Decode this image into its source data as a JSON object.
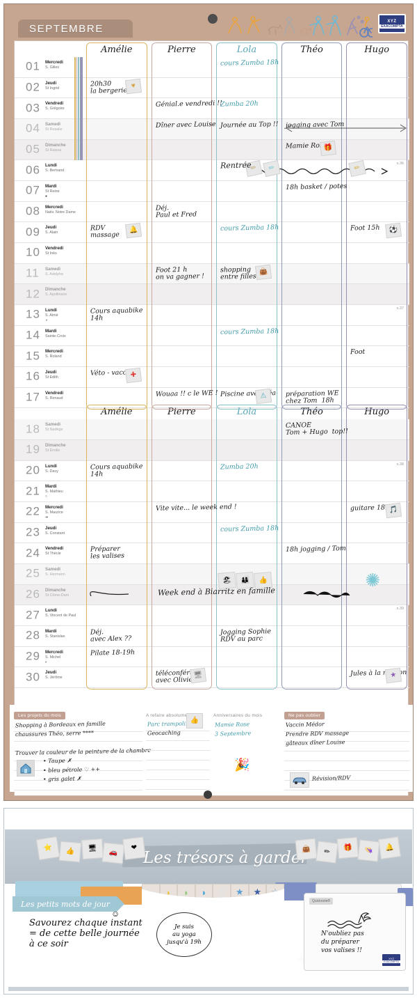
{
  "header": {
    "month": "SEPTEMBRE",
    "brand_line1": "XYZ",
    "brand_line2": "EXACOMPTA"
  },
  "columns": [
    {
      "name": "Amélie",
      "color": "#d9b45c"
    },
    {
      "name": "Pierre",
      "color": "#c9a9a2"
    },
    {
      "name": "Lola",
      "color": "#8cc0c8"
    },
    {
      "name": "Théo",
      "color": "#8f9bb5"
    },
    {
      "name": "Hugo",
      "color": "#9a8fb5"
    }
  ],
  "week_markers": [
    {
      "label": "s.36",
      "row": 5
    },
    {
      "label": "s.37",
      "row": 12
    },
    {
      "label": "s.38",
      "row": 19
    },
    {
      "label": "s.39",
      "row": 26
    }
  ],
  "days": [
    {
      "num": "01",
      "name": "Mercredi",
      "saint": "S. Gilles",
      "type": "week"
    },
    {
      "num": "02",
      "name": "Jeudi",
      "saint": "St Ingrid",
      "type": "week"
    },
    {
      "num": "03",
      "name": "Vendredi",
      "saint": "S. Grégoire",
      "type": "week"
    },
    {
      "num": "04",
      "name": "Samedi",
      "saint": "St Rosalie",
      "type": "sat"
    },
    {
      "num": "05",
      "name": "Dimanche",
      "saint": "St Raissa",
      "type": "sun"
    },
    {
      "num": "06",
      "name": "Lundi",
      "saint": "S. Bertrand",
      "type": "week"
    },
    {
      "num": "07",
      "name": "Mardi",
      "saint": "St Reine",
      "type": "week",
      "moon": "●"
    },
    {
      "num": "08",
      "name": "Mercredi",
      "saint": "Nativ. Notre Dame",
      "type": "week"
    },
    {
      "num": "09",
      "name": "Jeudi",
      "saint": "S. Alain",
      "type": "week"
    },
    {
      "num": "10",
      "name": "Vendredi",
      "saint": "St Inès",
      "type": "week"
    },
    {
      "num": "11",
      "name": "Samedi",
      "saint": "S. Adelphe",
      "type": "sat"
    },
    {
      "num": "12",
      "name": "Dimanche",
      "saint": "S. Apollinaire",
      "type": "sun"
    },
    {
      "num": "13",
      "name": "Lundi",
      "saint": "S. Aimé",
      "type": "week",
      "moon": "◑"
    },
    {
      "num": "14",
      "name": "Mardi",
      "saint": "Sainte-Croix",
      "type": "week"
    },
    {
      "num": "15",
      "name": "Mercredi",
      "saint": "S. Roland",
      "type": "week"
    },
    {
      "num": "16",
      "name": "Jeudi",
      "saint": "St Edith",
      "type": "week"
    },
    {
      "num": "17",
      "name": "Vendredi",
      "saint": "S. Renaud",
      "type": "week"
    },
    {
      "num": "18",
      "name": "Samedi",
      "saint": "St Nadège",
      "type": "sat"
    },
    {
      "num": "19",
      "name": "Dimanche",
      "saint": "St Émilie",
      "type": "sun"
    },
    {
      "num": "20",
      "name": "Lundi",
      "saint": "S. Davy",
      "type": "week"
    },
    {
      "num": "21",
      "name": "Mardi",
      "saint": "S. Mathieu",
      "type": "week",
      "moon": "○"
    },
    {
      "num": "22",
      "name": "Mercredi",
      "saint": "S. Maurice",
      "type": "week",
      "moon": "➔"
    },
    {
      "num": "23",
      "name": "Jeudi",
      "saint": "S. Constant",
      "type": "week"
    },
    {
      "num": "24",
      "name": "Vendredi",
      "saint": "St Thècle",
      "type": "week"
    },
    {
      "num": "25",
      "name": "Samedi",
      "saint": "S. Hermann",
      "type": "sat"
    },
    {
      "num": "26",
      "name": "Dimanche",
      "saint": "St Côme-Dam",
      "type": "sun"
    },
    {
      "num": "27",
      "name": "Lundi",
      "saint": "S. Vincent de Paul",
      "type": "week"
    },
    {
      "num": "28",
      "name": "Mardi",
      "saint": "S. Stanislas",
      "type": "week"
    },
    {
      "num": "29",
      "name": "Mercredi",
      "saint": "S. Michel",
      "type": "week",
      "moon": "◐"
    },
    {
      "num": "30",
      "name": "Jeudi",
      "saint": "S. Jérôme",
      "type": "week"
    }
  ],
  "entries": {
    "amelie": [
      {
        "row": 1,
        "text": "20h30\nla bergerie",
        "sticker": "♥",
        "sticker_color": "#d8a64a"
      },
      {
        "row": 8,
        "text": "RDV\nmassage",
        "sticker": "🔔",
        "sticker_color": "#5ba3c9"
      },
      {
        "row": 12,
        "text": "Cours aquabike\n14h"
      },
      {
        "row": 15,
        "text": "Véto - vaccin",
        "sticker": "✚",
        "sticker_color": "#e0443c"
      },
      {
        "row": 19,
        "text": "Cours aquabike\n14h"
      },
      {
        "row": 23,
        "text": "Préparer\nles valises"
      },
      {
        "row": 27,
        "text": "Déj.\navec Alex ??"
      },
      {
        "row": 28,
        "text": "Pilate 18-19h"
      }
    ],
    "pierre": [
      {
        "row": 2,
        "text": "Génial.e vendredi !!"
      },
      {
        "row": 3,
        "text": "Dîner avec Louise"
      },
      {
        "row": 7,
        "text": "Déj.\nPaul et Fred"
      },
      {
        "row": 10,
        "text": "Foot 21 h\non va gagner !"
      },
      {
        "row": 16,
        "text": "Wouaa !! c le WE !"
      },
      {
        "row": 21,
        "text": "Vite vite... le week end !"
      },
      {
        "row": 29,
        "text": "téléconférence\navec Olivier",
        "sticker": "🖥",
        "sticker_color": "#8a8a8a"
      }
    ],
    "lola": [
      {
        "row": 0,
        "text": "cours Zumba 18h",
        "blue": true
      },
      {
        "row": 2,
        "text": "Zumba 20h",
        "blue": true
      },
      {
        "row": 3,
        "text": "Journée au Top !!"
      },
      {
        "row": 8,
        "text": "cours Zumba 18h",
        "blue": true
      },
      {
        "row": 10,
        "text": "shopping\nentre filles",
        "sticker": "👜",
        "sticker_color": "#5a6fb5"
      },
      {
        "row": 13,
        "text": "cours Zumba 18h",
        "blue": true
      },
      {
        "row": 16,
        "text": "Piscine avec Léa",
        "sticker": "⚠",
        "sticker_color": "#4aa8bd"
      },
      {
        "row": 19,
        "text": "Zumba 20h",
        "blue": true
      },
      {
        "row": 22,
        "text": "cours Zumba 18h",
        "blue": true
      },
      {
        "row": 27,
        "text": "Jogging Sophie\nRDV au parc"
      }
    ],
    "theo": [
      {
        "row": 3,
        "text": "jogging avec Tom"
      },
      {
        "row": 4,
        "text": "Mamie Rose",
        "sticker": "🎁",
        "sticker_color": "#e05a9b"
      },
      {
        "row": 6,
        "text": "18h basket / potes"
      },
      {
        "row": 16,
        "text": "préparation WE\nchez Tom  18h"
      },
      {
        "row": 17,
        "text": "CANOE\nTom + Hugo  top!!"
      },
      {
        "row": 23,
        "text": "18h jogging / Tom"
      }
    ],
    "hugo": [
      {
        "row": 8,
        "text": "Foot 15h",
        "sticker": "⚽",
        "sticker_color": "#3f6fb5"
      },
      {
        "row": 14,
        "text": "Foot"
      },
      {
        "row": 21,
        "text": "guitare 18h",
        "sticker": "🎵",
        "sticker_color": "#7a4fa8"
      },
      {
        "row": 29,
        "text": "Jules à la maison",
        "sticker": "★",
        "sticker_color": "#8b5fb5"
      }
    ],
    "banners": [
      {
        "row": 5,
        "text": "Rentrée",
        "kind": "rentree"
      },
      {
        "row": 25,
        "text": "Week end à Biarritz en famille",
        "kind": "weekend"
      }
    ]
  },
  "notes": {
    "projets": {
      "tag": "Les projets du mois",
      "lines": [
        "Shopping à Bordeaux en famille",
        "chaussures Théo, serre ****",
        "Trouver la couleur de la peinture de la chambre",
        "• Taupe ✗",
        "• bleu pétrole ♡ ++",
        "• gris galet ✗"
      ]
    },
    "afaire": {
      "tag": "A refaire absolument",
      "lines": [
        "Parc trampoline",
        "Geocaching"
      ]
    },
    "anniversaires": {
      "tag": "Anniversaires du mois",
      "lines": [
        "Mamie Rose",
        "3 Septembre"
      ]
    },
    "oublier": {
      "tag": "Ne pas oublier",
      "lines": [
        "Vaccin Médor",
        "Prendre RDV massage",
        "gâteaux dîner Louise",
        "Révision/RDV"
      ]
    }
  },
  "bottom": {
    "tresors_title": "Les trésors à garder",
    "mots_title": "Les petits mots de jour",
    "quote": "Savourez chaque instant\n= de cette belle journée\nà ce soir",
    "oval": "Je suis\nau yoga\njusqu'à 19h",
    "quicknote_tag": "Quicknote®",
    "quicknote_text": "N'oubliez pas\ndu préparer\nvos valises !!",
    "sticker_row": [
      "◗",
      "◗",
      "◗",
      "◗",
      "☆",
      "★",
      "★",
      "☆"
    ]
  }
}
